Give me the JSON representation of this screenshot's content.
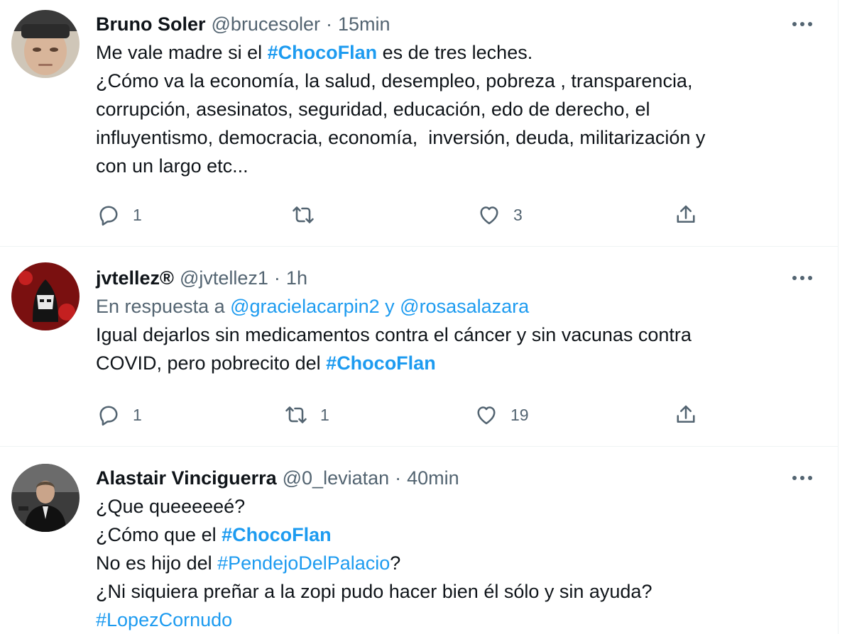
{
  "colors": {
    "link": "#1d9bf0",
    "secondary": "#536471",
    "text": "#0f1419",
    "divider": "#eff3f4"
  },
  "tweets": [
    {
      "name": "Bruno Soler",
      "handle": "@brucesoler",
      "separator": "·",
      "time": "15min",
      "lines": [
        [
          "Me vale madre si el ",
          "#ChocoFlan",
          " es de tres leches."
        ],
        [
          "¿Cómo va la economía, la salud, desempleo, pobreza , transparencia,"
        ],
        [
          "corrupción, asesinatos, seguridad, educación, edo de derecho, el"
        ],
        [
          "influyentismo, democracia, economía,  inversión, deuda, militarización y"
        ],
        [
          "con un largo etc..."
        ]
      ],
      "reply_count": "1",
      "retweet_count": "",
      "like_count": "3"
    },
    {
      "name": "jvtellez®",
      "handle": "@jvtellez1",
      "separator": "·",
      "time": "1h",
      "reply_prefix": "En respuesta a ",
      "reply_to_1": "@gracielacarpin2",
      "reply_and": " y ",
      "reply_to_2": "@rosasalazara",
      "lines": [
        [
          "Igual dejarlos sin medicamentos contra el cáncer y sin vacunas contra"
        ],
        [
          "COVID, pero pobrecito del ",
          "#ChocoFlan"
        ]
      ],
      "reply_count": "1",
      "retweet_count": "1",
      "like_count": "19"
    },
    {
      "name": "Alastair Vinciguerra",
      "handle": "@0_leviatan",
      "separator": "·",
      "time": "40min",
      "lines": [
        [
          "¿Que queeeeeé?"
        ],
        [
          "¿Cómo que el ",
          "#ChocoFlan"
        ],
        [
          "No es hijo del ",
          "#PendejoDelPalacio",
          "?"
        ],
        [
          "¿Ni siquiera preñar a la zopi pudo hacer bien él sólo y sin ayuda?"
        ],
        [
          "",
          "#LopezCornudo"
        ]
      ]
    }
  ],
  "icons": {
    "more": "more-horizontal-icon",
    "reply": "reply-icon",
    "retweet": "retweet-icon",
    "like": "heart-icon",
    "share": "share-icon"
  }
}
